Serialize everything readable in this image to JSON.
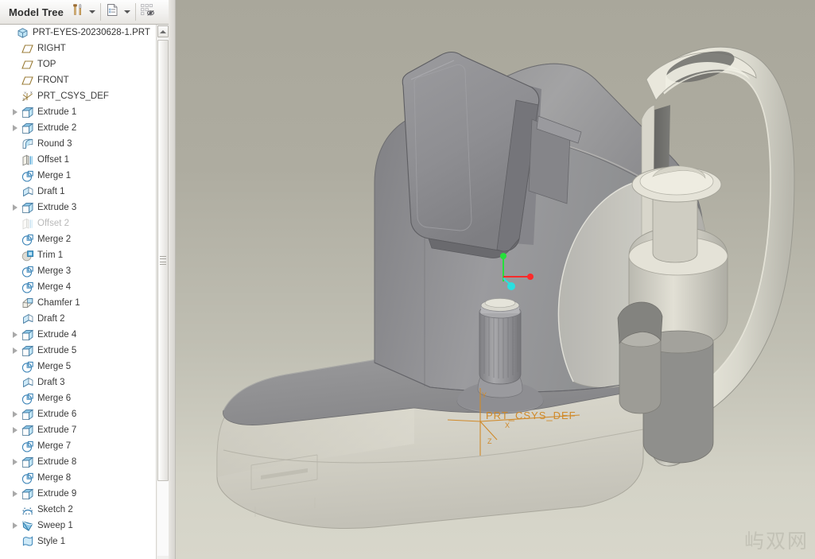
{
  "toolbar": {
    "title": "Model Tree",
    "tools_icon": "hammer-screwdriver-icon",
    "tools_dropdown": "chevron-down-icon",
    "settings_icon": "document-list-icon",
    "settings_dropdown": "chevron-down-icon",
    "filter_icon": "tree-filter-hidden-icon"
  },
  "tree": {
    "items": [
      {
        "label": "PRT-EYES-20230628-1.PRT",
        "icon": "part-icon",
        "indent": 0,
        "expandable": false,
        "suppressed": false
      },
      {
        "label": "RIGHT",
        "icon": "datum-plane-icon",
        "indent": 1,
        "expandable": false,
        "suppressed": false
      },
      {
        "label": "TOP",
        "icon": "datum-plane-icon",
        "indent": 1,
        "expandable": false,
        "suppressed": false
      },
      {
        "label": "FRONT",
        "icon": "datum-plane-icon",
        "indent": 1,
        "expandable": false,
        "suppressed": false
      },
      {
        "label": "PRT_CSYS_DEF",
        "icon": "coord-system-icon",
        "indent": 1,
        "expandable": false,
        "suppressed": false
      },
      {
        "label": "Extrude 1",
        "icon": "extrude-icon",
        "indent": 1,
        "expandable": true,
        "suppressed": false
      },
      {
        "label": "Extrude 2",
        "icon": "extrude-icon",
        "indent": 1,
        "expandable": true,
        "suppressed": false
      },
      {
        "label": "Round 3",
        "icon": "round-icon",
        "indent": 1,
        "expandable": false,
        "suppressed": false
      },
      {
        "label": "Offset 1",
        "icon": "offset-icon",
        "indent": 1,
        "expandable": false,
        "suppressed": false
      },
      {
        "label": "Merge 1",
        "icon": "merge-icon",
        "indent": 1,
        "expandable": false,
        "suppressed": false
      },
      {
        "label": "Draft 1",
        "icon": "draft-icon",
        "indent": 1,
        "expandable": false,
        "suppressed": false
      },
      {
        "label": "Extrude 3",
        "icon": "extrude-icon",
        "indent": 1,
        "expandable": true,
        "suppressed": false
      },
      {
        "label": "Offset 2",
        "icon": "offset-icon",
        "indent": 1,
        "expandable": false,
        "suppressed": true
      },
      {
        "label": "Merge 2",
        "icon": "merge-icon",
        "indent": 1,
        "expandable": false,
        "suppressed": false
      },
      {
        "label": "Trim 1",
        "icon": "trim-icon",
        "indent": 1,
        "expandable": false,
        "suppressed": false
      },
      {
        "label": "Merge 3",
        "icon": "merge-icon",
        "indent": 1,
        "expandable": false,
        "suppressed": false
      },
      {
        "label": "Merge 4",
        "icon": "merge-icon",
        "indent": 1,
        "expandable": false,
        "suppressed": false
      },
      {
        "label": "Chamfer 1",
        "icon": "chamfer-icon",
        "indent": 1,
        "expandable": false,
        "suppressed": false
      },
      {
        "label": "Draft 2",
        "icon": "draft-icon",
        "indent": 1,
        "expandable": false,
        "suppressed": false
      },
      {
        "label": "Extrude 4",
        "icon": "extrude-icon",
        "indent": 1,
        "expandable": true,
        "suppressed": false
      },
      {
        "label": "Extrude 5",
        "icon": "extrude-icon",
        "indent": 1,
        "expandable": true,
        "suppressed": false
      },
      {
        "label": "Merge 5",
        "icon": "merge-icon",
        "indent": 1,
        "expandable": false,
        "suppressed": false
      },
      {
        "label": "Draft 3",
        "icon": "draft-icon",
        "indent": 1,
        "expandable": false,
        "suppressed": false
      },
      {
        "label": "Merge 6",
        "icon": "merge-icon",
        "indent": 1,
        "expandable": false,
        "suppressed": false
      },
      {
        "label": "Extrude 6",
        "icon": "extrude-icon",
        "indent": 1,
        "expandable": true,
        "suppressed": false
      },
      {
        "label": "Extrude 7",
        "icon": "extrude-icon",
        "indent": 1,
        "expandable": true,
        "suppressed": false
      },
      {
        "label": "Merge 7",
        "icon": "merge-icon",
        "indent": 1,
        "expandable": false,
        "suppressed": false
      },
      {
        "label": "Extrude 8",
        "icon": "extrude-icon",
        "indent": 1,
        "expandable": true,
        "suppressed": false
      },
      {
        "label": "Merge 8",
        "icon": "merge-icon",
        "indent": 1,
        "expandable": false,
        "suppressed": false
      },
      {
        "label": "Extrude 9",
        "icon": "extrude-icon",
        "indent": 1,
        "expandable": true,
        "suppressed": false
      },
      {
        "label": "Sketch 2",
        "icon": "sketch-icon",
        "indent": 1,
        "expandable": false,
        "suppressed": false
      },
      {
        "label": "Sweep 1",
        "icon": "sweep-icon",
        "indent": 1,
        "expandable": true,
        "suppressed": false
      },
      {
        "label": "Style 1",
        "icon": "style-icon",
        "indent": 1,
        "expandable": false,
        "suppressed": false
      }
    ]
  },
  "scrollbar": {
    "up_arrow_icon": "scroll-up-arrow-icon",
    "grip_icon": "scroll-grip-icon"
  },
  "viewport": {
    "csys_label": "PRT_CSYS_DEF",
    "axis_x_label": "X",
    "axis_y_label": "Y",
    "axis_z_label": "Z",
    "watermark": "屿双网",
    "triad": {
      "x_axis_color": "#ff2a2a",
      "y_axis_color": "#25e03a",
      "z_axis_color": "#2ae0e0"
    },
    "colors": {
      "background_top": "#a9a79b",
      "background_bottom": "#d8d7cb",
      "body_gray": "#909093",
      "body_light": "#c9c8bf",
      "base_cream": "#d8d7cc",
      "datum_orange": "#d08a2a"
    }
  }
}
